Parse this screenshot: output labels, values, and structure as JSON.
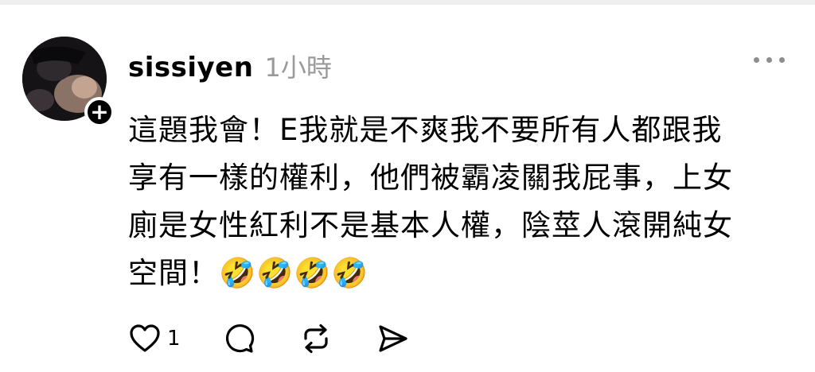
{
  "post": {
    "username": "sissiyen",
    "time": "1小時",
    "follow_badge": "+",
    "body_lines": [
      "這題我會！E我就是不爽我不要所有人都跟我",
      "享有一樣的權利，他們被霸凌關我屁事，上女",
      "廁是女性紅利不是基本人權，陰莖人滾開純女",
      "空間！🤣🤣🤣🤣"
    ],
    "like_count": "1"
  },
  "icons": {
    "more": "more-horizontal-icon",
    "like": "heart-icon",
    "comment": "comment-icon",
    "repost": "repost-icon",
    "share": "send-icon",
    "follow": "plus-icon"
  }
}
